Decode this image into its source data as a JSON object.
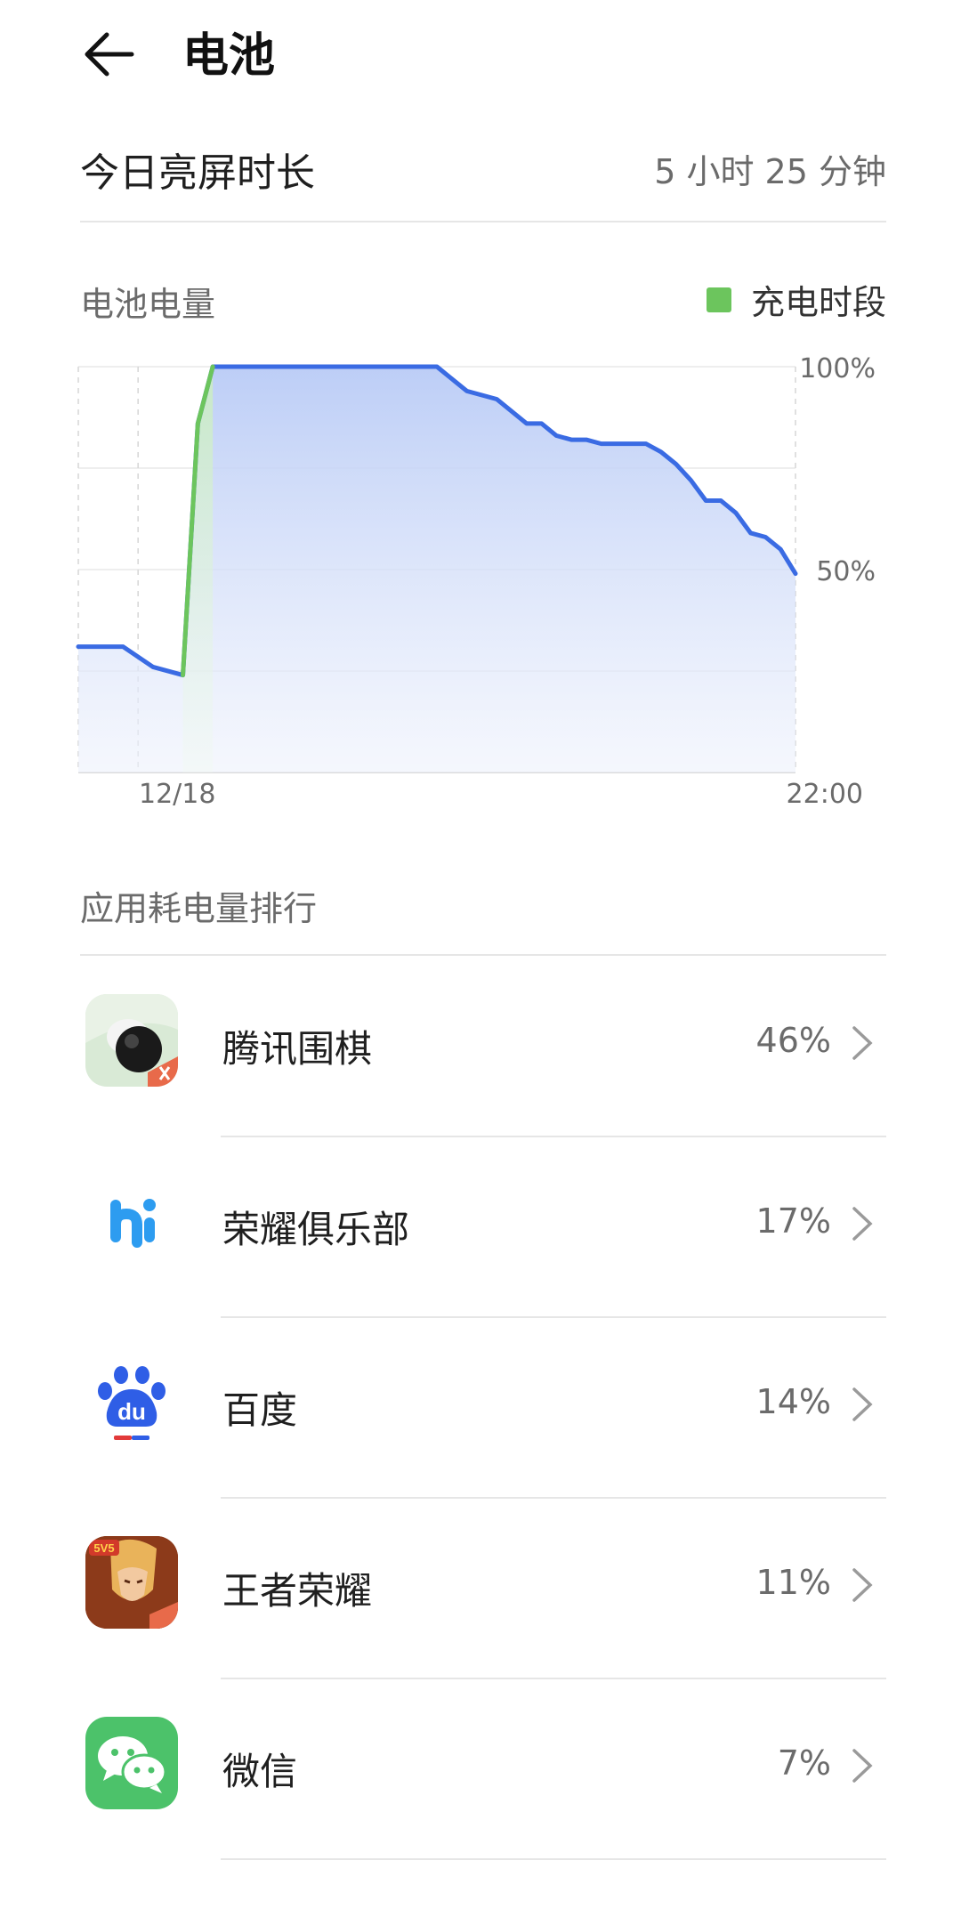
{
  "header": {
    "title": "电池",
    "back_icon": "arrow-left-icon"
  },
  "screen_time": {
    "label": "今日亮屏时长",
    "value": "5 小时 25 分钟"
  },
  "battery_section": {
    "label": "电池电量",
    "legend_label": "充电时段",
    "legend_color": "#6cc55d",
    "line_color": "#3a6be3"
  },
  "chart_data": {
    "type": "line",
    "y_ticks": [
      "100%",
      "50%"
    ],
    "x_ticks": [
      "12/18",
      "22:00"
    ],
    "ylim": [
      0,
      100
    ],
    "series": [
      {
        "name": "",
        "points": [
          [
            0,
            31
          ],
          [
            3,
            31
          ],
          [
            5,
            26
          ],
          [
            7,
            24
          ],
          [
            8,
            86
          ],
          [
            9,
            100
          ],
          [
            24,
            100
          ],
          [
            26,
            94
          ],
          [
            28,
            92
          ],
          [
            30,
            86
          ],
          [
            31,
            86
          ],
          [
            32,
            83
          ],
          [
            33,
            82
          ],
          [
            34,
            82
          ],
          [
            35,
            81
          ],
          [
            38,
            81
          ],
          [
            39,
            79
          ],
          [
            40,
            76
          ],
          [
            41,
            72
          ],
          [
            42,
            67
          ],
          [
            43,
            67
          ],
          [
            44,
            64
          ],
          [
            45,
            59
          ],
          [
            46,
            58
          ],
          [
            47,
            55
          ],
          [
            48,
            49
          ]
        ]
      }
    ],
    "charging_segment": [
      [
        7,
        24
      ],
      [
        8,
        86
      ],
      [
        9,
        100
      ]
    ]
  },
  "ranking": {
    "label": "应用耗电量排行",
    "apps": [
      {
        "name": "腾讯围棋",
        "percent": "46%",
        "icon": "tencent-go-icon"
      },
      {
        "name": "荣耀俱乐部",
        "percent": "17%",
        "icon": "honor-club-icon"
      },
      {
        "name": "百度",
        "percent": "14%",
        "icon": "baidu-icon"
      },
      {
        "name": "王者荣耀",
        "percent": "11%",
        "icon": "honor-of-kings-icon"
      },
      {
        "name": "微信",
        "percent": "7%",
        "icon": "wechat-icon"
      }
    ]
  }
}
